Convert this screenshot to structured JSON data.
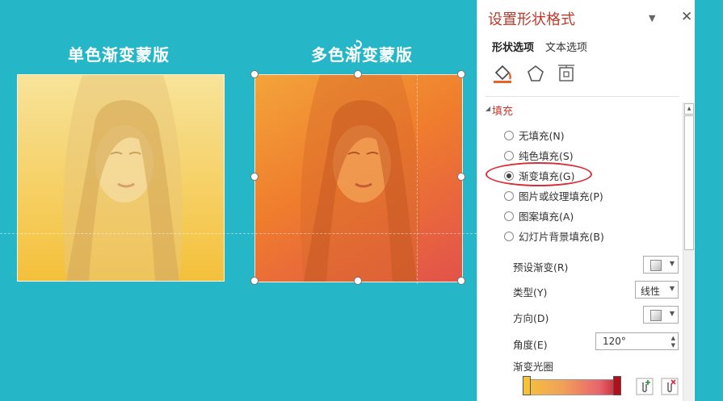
{
  "slide": {
    "title_left": "单色渐变蒙版",
    "title_right": "多色渐变蒙版"
  },
  "panel": {
    "title": "设置形状格式",
    "tabs": [
      "形状选项",
      "文本选项"
    ],
    "section": "填充",
    "fill_options": [
      {
        "label": "无填充(N)",
        "selected": false
      },
      {
        "label": "纯色填充(S)",
        "selected": false
      },
      {
        "label": "渐变填充(G)",
        "selected": true
      },
      {
        "label": "图片或纹理填充(P)",
        "selected": false
      },
      {
        "label": "图案填充(A)",
        "selected": false
      },
      {
        "label": "幻灯片背景填充(B)",
        "selected": false
      }
    ],
    "preset_label": "预设渐变(R)",
    "type_label": "类型(Y)",
    "type_value": "线性",
    "direction_label": "方向(D)",
    "angle_label": "角度(E)",
    "angle_value": "120°",
    "gradient_stops_label": "渐变光圈"
  },
  "colors": {
    "background": "#25b6c8",
    "accent": "#c0392b",
    "highlight_ring": "#d62f3a"
  }
}
